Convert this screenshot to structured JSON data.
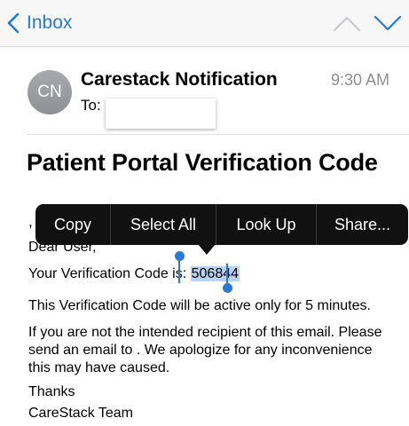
{
  "nav": {
    "back_label": "Inbox",
    "back_icon": "chevron-left-icon",
    "prev_icon": "chevron-up-icon",
    "next_icon": "chevron-down-icon",
    "accent_color": "#1f7ae0"
  },
  "message": {
    "avatar_initials": "CN",
    "sender": "Carestack Notification",
    "time": "9:30 AM",
    "to_label": "To:",
    "subject": "Patient Portal Verification Code",
    "stray_text": ",",
    "greeting": "Dear User,",
    "code_prefix": "Your Verification Code is: ",
    "code": "506844",
    "line_active": "This Verification Code will be active only for 5 minutes.",
    "line_recipient": "If you are not the intended recipient of this email. Please send an email to . We apologize for any inconvenience this may have caused.",
    "thanks": "Thanks",
    "signature": "CareStack Team"
  },
  "context_menu": {
    "items": [
      "Copy",
      "Select All",
      "Look Up",
      "Share..."
    ]
  },
  "selection_color": "#b8d3f1"
}
